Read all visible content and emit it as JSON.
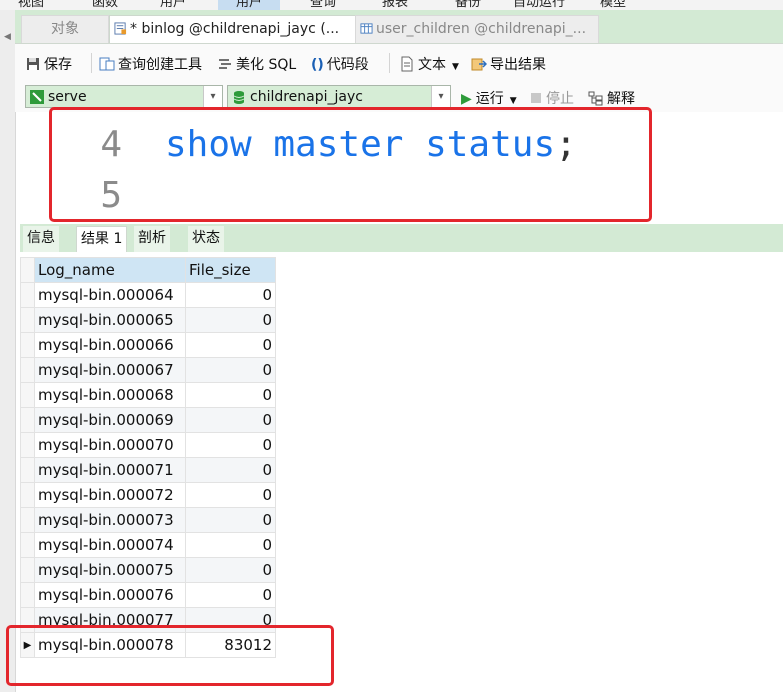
{
  "menu": {
    "items": [
      "视图",
      "函数",
      "用户",
      "查询",
      "报表",
      "备份",
      "自动运行",
      "模型"
    ]
  },
  "tabs": [
    {
      "label": "对象",
      "active": false
    },
    {
      "label": "* binlog @childrenapi_jayc (...",
      "active": true
    },
    {
      "label": "user_children @childrenapi_...",
      "active": false
    }
  ],
  "toolbar": {
    "save": "保存",
    "query_builder": "查询创建工具",
    "beautify_sql": "美化 SQL",
    "code_snippet": "代码段",
    "text": "文本",
    "export_results": "导出结果"
  },
  "connection": {
    "server": "serve",
    "database": "childrenapi_jayc",
    "run": "运行",
    "stop": "停止",
    "explain": "解释"
  },
  "editor": {
    "line_numbers": [
      "4",
      "5"
    ],
    "query": "show master status",
    "terminator": ";"
  },
  "result_tabs": [
    "信息",
    "结果 1",
    "剖析",
    "状态"
  ],
  "grid": {
    "columns": [
      "Log_name",
      "File_size"
    ],
    "rows": [
      {
        "log_name": "mysql-bin.000064",
        "file_size": "0"
      },
      {
        "log_name": "mysql-bin.000065",
        "file_size": "0"
      },
      {
        "log_name": "mysql-bin.000066",
        "file_size": "0"
      },
      {
        "log_name": "mysql-bin.000067",
        "file_size": "0"
      },
      {
        "log_name": "mysql-bin.000068",
        "file_size": "0"
      },
      {
        "log_name": "mysql-bin.000069",
        "file_size": "0"
      },
      {
        "log_name": "mysql-bin.000070",
        "file_size": "0"
      },
      {
        "log_name": "mysql-bin.000071",
        "file_size": "0"
      },
      {
        "log_name": "mysql-bin.000072",
        "file_size": "0"
      },
      {
        "log_name": "mysql-bin.000073",
        "file_size": "0"
      },
      {
        "log_name": "mysql-bin.000074",
        "file_size": "0"
      },
      {
        "log_name": "mysql-bin.000075",
        "file_size": "0"
      },
      {
        "log_name": "mysql-bin.000076",
        "file_size": "0"
      },
      {
        "log_name": "mysql-bin.000077",
        "file_size": "0"
      },
      {
        "log_name": "mysql-bin.000078",
        "file_size": "83012",
        "current": true
      }
    ]
  },
  "colors": {
    "tab_bar": "#d3ead4",
    "combo_bg": "#d6edd6",
    "sql_keyword": "#1a73e8",
    "annotation_red": "#e3262c",
    "header_blue": "#cfe5f4"
  }
}
